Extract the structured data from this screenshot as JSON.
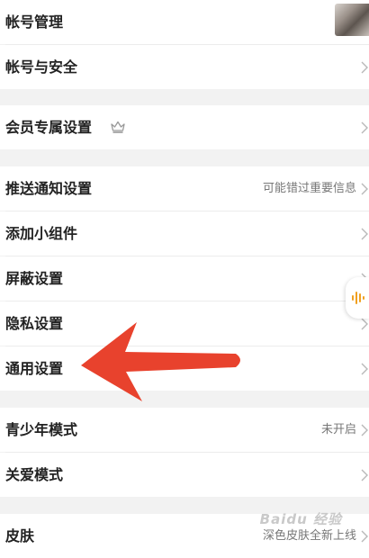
{
  "colors": {
    "background": "#f2f2f2",
    "row": "#ffffff",
    "text": "#222222",
    "secondary": "#777777",
    "chevron": "#b8b8b8",
    "voice_accent": "#f0a020",
    "arrow": "#e8422d"
  },
  "settings": {
    "account_manage": {
      "label": "帐号管理"
    },
    "account_security": {
      "label": "帐号与安全"
    },
    "vip_settings": {
      "label": "会员专属设置",
      "icon": "crown-icon"
    },
    "push_settings": {
      "label": "推送通知设置",
      "value": "可能错过重要信息"
    },
    "add_widget": {
      "label": "添加小组件"
    },
    "block_settings": {
      "label": "屏蔽设置"
    },
    "privacy_settings": {
      "label": "隐私设置"
    },
    "general_settings": {
      "label": "通用设置"
    },
    "teen_mode": {
      "label": "青少年模式",
      "value": "未开启"
    },
    "care_mode": {
      "label": "关爱模式"
    },
    "skin": {
      "label": "皮肤",
      "value": "深色皮肤全新上线"
    }
  },
  "watermark": "Baidu 经验"
}
